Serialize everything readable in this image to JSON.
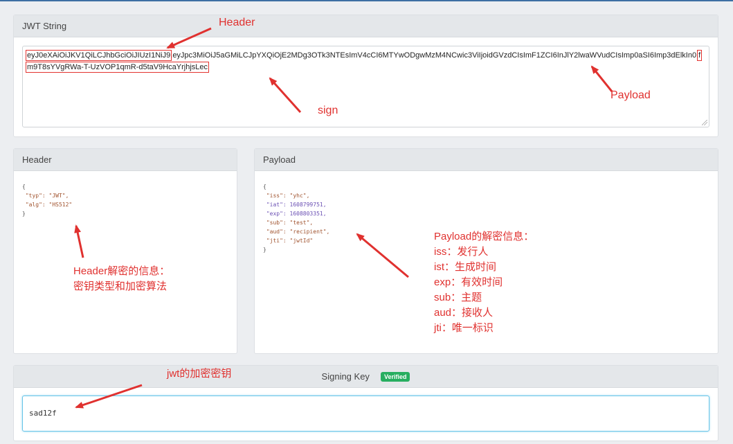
{
  "jwt_panel": {
    "title": "JWT String",
    "header_part": "eyJ0eXAiOiJKV1QiLCJhbGciOiJIUzI1NiJ9",
    "payload_part_line1": "eyJpc3MiOiJ5aGMiLCJpYXQiOjE2MDg3OTk3NTEsImV4cCI6MTYwODgwMzM4NCwic3ViIjoidGVzdCIsImF1ZCI6InJlY2lwaWVudCIsImp0a",
    "payload_part_line2": "SI6Imp3dElkIn0",
    "sign_part": "fm9T8sYVgRWa-T-UzVOP1qmR-d5taV9HcaYrjhjsLec"
  },
  "header_panel": {
    "title": "Header",
    "code_lines": [
      "{",
      " \"typ\": \"JWT\",",
      " \"alg\": \"HS512\"",
      "}"
    ]
  },
  "payload_panel": {
    "title": "Payload",
    "code_lines": [
      "{",
      " \"iss\": \"yhc\",",
      " \"iat\": 1608799751,",
      " \"exp\": 1608803351,",
      " \"sub\": \"test\",",
      " \"aud\": \"recipient\",",
      " \"jti\": \"jwtId\"",
      "}"
    ]
  },
  "signing": {
    "label": "Signing Key",
    "badge": "Verified",
    "value": "sad12f"
  },
  "annotations": {
    "header": "Header",
    "payload": "Payload",
    "sign": "sign",
    "header_decode_1": "Header解密的信息：",
    "header_decode_2": "密钥类型和加密算法",
    "payload_title": "Payload的解密信息：",
    "payload_lines": [
      "iss：发行人",
      "ist：生成时间",
      "exp：有效时间",
      "sub：主题",
      "aud：接收人",
      "jti：唯一标识"
    ],
    "jwt_key": "jwt的加密密钥"
  },
  "colors": {
    "annotation_red": "#e0312f",
    "verified_green": "#27ae60",
    "input_focus": "#66c4e8"
  }
}
